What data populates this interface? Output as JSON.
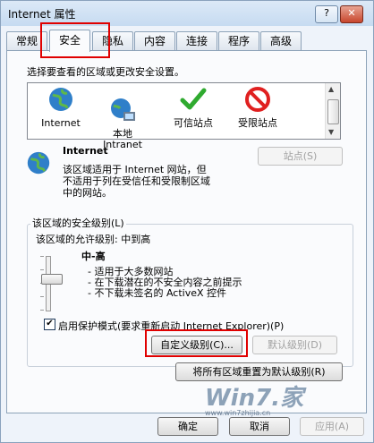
{
  "window": {
    "title": "Internet 属性",
    "help": "?",
    "close": "✕"
  },
  "tabs": [
    "常规",
    "安全",
    "隐私",
    "内容",
    "连接",
    "程序",
    "高级"
  ],
  "zones_prompt": "选择要查看的区域或更改安全设置。",
  "zones": [
    {
      "name": "Internet",
      "icon": "globe-icon"
    },
    {
      "name": "本地\nIntranet",
      "icon": "intranet-icon"
    },
    {
      "name": "可信站点",
      "icon": "checkmark-icon"
    },
    {
      "name": "受限站点",
      "icon": "restricted-icon"
    }
  ],
  "zone_detail": {
    "title": "Internet",
    "desc1": "该区域适用于 Internet 网站，但",
    "desc2": "不适用于列在受信任和受限制区域",
    "desc3": "中的网站。",
    "sites_button": "站点(S)"
  },
  "security": {
    "group_label": "该区域的安全级别(L)",
    "allowed": "该区域的允许级别: 中到高",
    "level": "中-高",
    "bullets": [
      "- 适用于大多数网站",
      "- 在下载潜在的不安全内容之前提示",
      "- 不下载未签名的 ActiveX 控件"
    ],
    "protected_mode": "启用保护模式(要求重新启动 Internet Explorer)(P)",
    "custom_button": "自定义级别(C)...",
    "default_button": "默认级别(D)",
    "reset_all_button": "将所有区域重置为默认级别(R)"
  },
  "footer": {
    "ok": "确定",
    "cancel": "取消",
    "apply": "应用(A)"
  },
  "watermark": {
    "brand": "Win7.家",
    "url": "www.win7zhijia.cn"
  }
}
